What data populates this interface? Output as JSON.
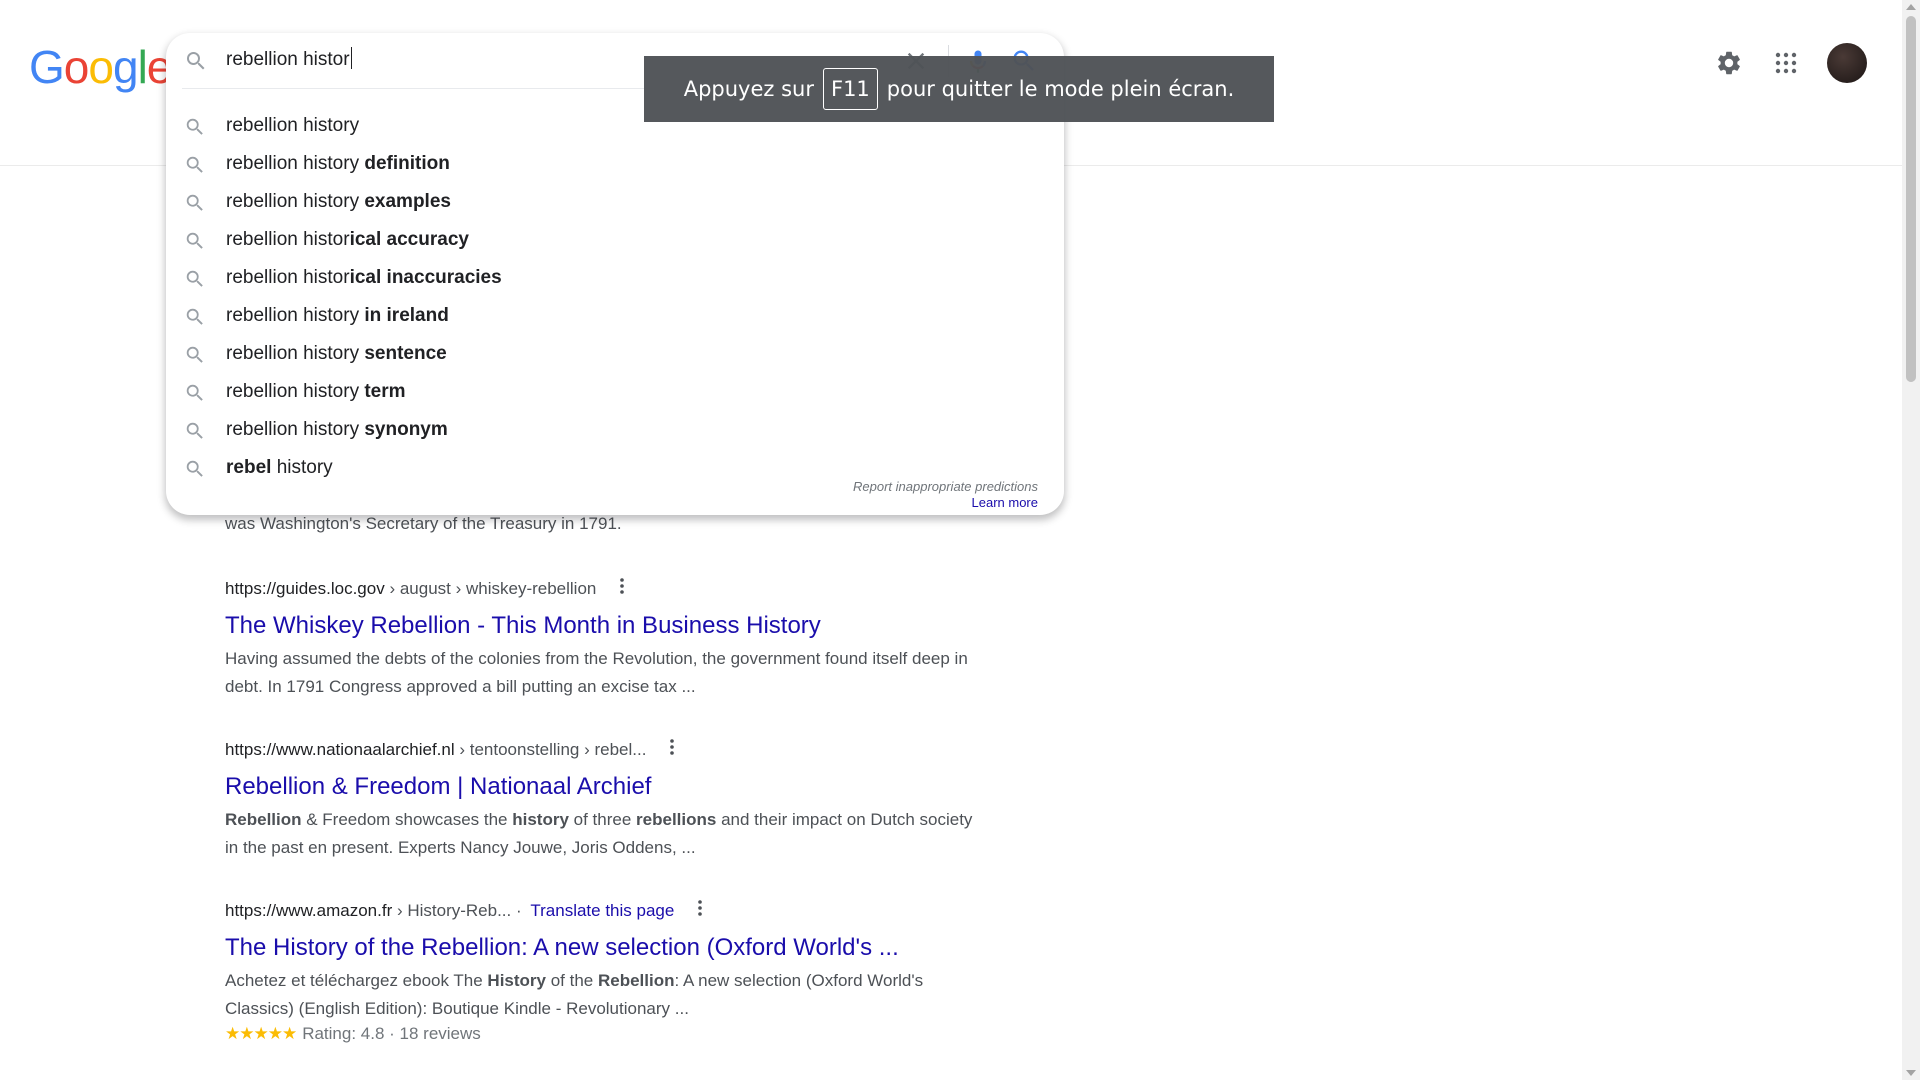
{
  "logo": {
    "letters": [
      "G",
      "o",
      "o",
      "g",
      "l",
      "e"
    ],
    "colors": [
      "#4285F4",
      "#EA4335",
      "#FBBC05",
      "#4285F4",
      "#34A853",
      "#EA4335"
    ]
  },
  "search": {
    "query": "rebellion histor"
  },
  "suggestions": [
    {
      "prefix": "rebellion history",
      "bold": ""
    },
    {
      "prefix": "rebellion history",
      "bold": " definition"
    },
    {
      "prefix": "rebellion history",
      "bold": " examples"
    },
    {
      "prefix": "rebellion histor",
      "bold": "ical accuracy"
    },
    {
      "prefix": "rebellion histor",
      "bold": "ical inaccuracies"
    },
    {
      "prefix": "rebellion history",
      "bold": " in ireland"
    },
    {
      "prefix": "rebellion history",
      "bold": " sentence"
    },
    {
      "prefix": "rebellion history",
      "bold": " term"
    },
    {
      "prefix": "rebellion history",
      "bold": " synonym"
    },
    {
      "prefix": "",
      "bold": "rebel",
      "suffix": " history"
    }
  ],
  "report": {
    "text": "Report inappropriate predictions",
    "link": "Learn more"
  },
  "fullscreen_toast": {
    "before": "Appuyez sur",
    "key": "F11",
    "after": "pour quitter le mode plein écran."
  },
  "partial_snippet": "was Washington's Secretary of the Treasury in 1791.",
  "results": [
    {
      "domain": "https://guides.loc.gov",
      "path": " › august › whiskey-rebellion",
      "title": "The Whiskey Rebellion - This Month in Business History",
      "snippet": "Having assumed the debts of the colonies from the Revolution, the government found itself deep in debt. In 1791 Congress approved a bill putting an excise tax ..."
    },
    {
      "domain": "https://www.nationaalarchief.nl",
      "path": " › tentoonstelling › rebel...",
      "title": "Rebellion & Freedom | Nationaal Archief",
      "snippet_parts": [
        {
          "b": true,
          "t": "Rebellion"
        },
        {
          "b": false,
          "t": " & Freedom showcases the "
        },
        {
          "b": true,
          "t": "history"
        },
        {
          "b": false,
          "t": " of three "
        },
        {
          "b": true,
          "t": "rebellions"
        },
        {
          "b": false,
          "t": " and their impact on Dutch society in the past en present. Experts Nancy Jouwe, Joris Oddens, ..."
        }
      ]
    },
    {
      "domain": "https://www.amazon.fr",
      "path": " › History-Reb...",
      "separator": " · ",
      "translate": "Translate this page",
      "title": "The History of the Rebellion: A new selection (Oxford World's ...",
      "snippet_parts": [
        {
          "b": false,
          "t": "Achetez et téléchargez ebook The "
        },
        {
          "b": true,
          "t": "History"
        },
        {
          "b": false,
          "t": " of the "
        },
        {
          "b": true,
          "t": "Rebellion"
        },
        {
          "b": false,
          "t": ": A new selection (Oxford World's Classics) (English Edition): Boutique Kindle - Revolutionary ..."
        }
      ],
      "stars": "★★★★★",
      "rating_text": "Rating: 4.8 · 18 reviews"
    }
  ]
}
